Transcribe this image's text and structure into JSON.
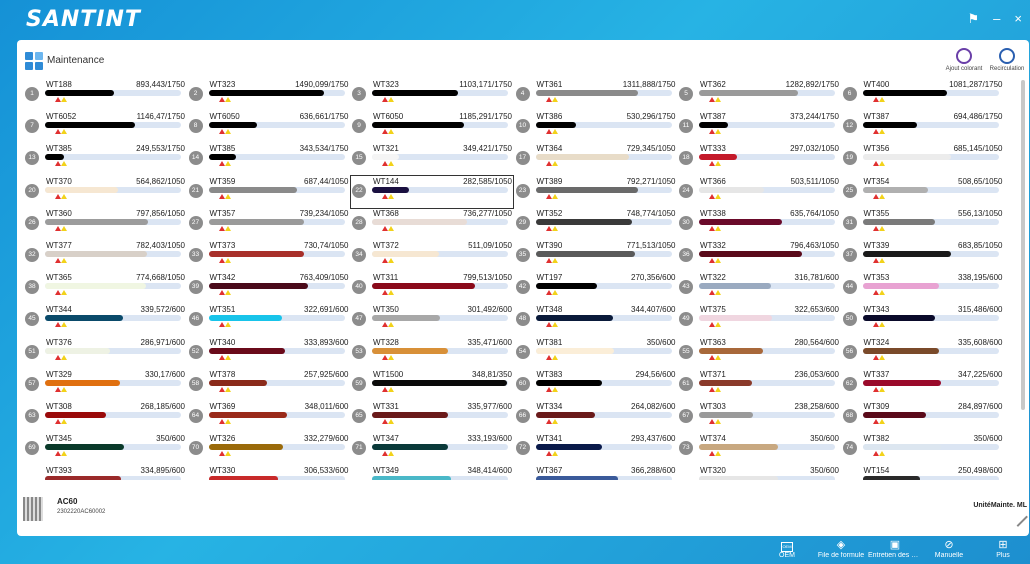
{
  "app": {
    "logo": "SANTINT",
    "theme_icon": "tshirt-icon",
    "minimize": "–",
    "close": "×"
  },
  "panel": {
    "title": "Maintenance",
    "buttons": [
      {
        "label": "Ajout colorant",
        "icon": "tank-icon"
      },
      {
        "label": "Recirculation",
        "icon": "recirculation-icon"
      }
    ]
  },
  "cells": [
    {
      "n": "1",
      "name": "WT188",
      "value": "893,443/1750",
      "fill": 0.51,
      "color": "#000000"
    },
    {
      "n": "2",
      "name": "WT323",
      "value": "1490,099/1750",
      "fill": 0.85,
      "color": "#000000"
    },
    {
      "n": "3",
      "name": "WT323",
      "value": "1103,171/1750",
      "fill": 0.63,
      "color": "#000000"
    },
    {
      "n": "4",
      "name": "WT361",
      "value": "1311,888/1750",
      "fill": 0.75,
      "color": "#8a8a8a"
    },
    {
      "n": "5",
      "name": "WT362",
      "value": "1282,892/1750",
      "fill": 0.73,
      "color": "#9a9a9a"
    },
    {
      "n": "6",
      "name": "WT400",
      "value": "1081,287/1750",
      "fill": 0.62,
      "color": "#000000"
    },
    {
      "n": "7",
      "name": "WT6052",
      "value": "1146,47/1750",
      "fill": 0.66,
      "color": "#000000"
    },
    {
      "n": "8",
      "name": "WT6050",
      "value": "636,661/1750",
      "fill": 0.36,
      "color": "#000000"
    },
    {
      "n": "9",
      "name": "WT6050",
      "value": "1185,291/1750",
      "fill": 0.68,
      "color": "#000000"
    },
    {
      "n": "10",
      "name": "WT386",
      "value": "530,296/1750",
      "fill": 0.3,
      "color": "#000000"
    },
    {
      "n": "11",
      "name": "WT387",
      "value": "373,244/1750",
      "fill": 0.21,
      "color": "#000000"
    },
    {
      "n": "12",
      "name": "WT387",
      "value": "694,486/1750",
      "fill": 0.4,
      "color": "#000000"
    },
    {
      "n": "13",
      "name": "WT385",
      "value": "249,553/1750",
      "fill": 0.14,
      "color": "#000000"
    },
    {
      "n": "14",
      "name": "WT385",
      "value": "343,534/1750",
      "fill": 0.2,
      "color": "#000000"
    },
    {
      "n": "15",
      "name": "WT321",
      "value": "349,421/1750",
      "fill": 0.2,
      "color": "#f5f5f5"
    },
    {
      "n": "17",
      "name": "WT364",
      "value": "729,345/1050",
      "fill": 0.69,
      "color": "#e8dcc8"
    },
    {
      "n": "18",
      "name": "WT333",
      "value": "297,032/1050",
      "fill": 0.28,
      "color": "#c41a2a"
    },
    {
      "n": "19",
      "name": "WT356",
      "value": "685,145/1050",
      "fill": 0.65,
      "color": "#ececec"
    },
    {
      "n": "20",
      "name": "WT370",
      "value": "564,862/1050",
      "fill": 0.54,
      "color": "#f6e7d2"
    },
    {
      "n": "21",
      "name": "WT359",
      "value": "687,44/1050",
      "fill": 0.65,
      "color": "#8a8a8a"
    },
    {
      "n": "22",
      "name": "WT144",
      "value": "282,585/1050",
      "fill": 0.27,
      "color": "#1a1040"
    },
    {
      "n": "23",
      "name": "WT389",
      "value": "792,271/1050",
      "fill": 0.75,
      "color": "#6a6a6a"
    },
    {
      "n": "24",
      "name": "WT366",
      "value": "503,511/1050",
      "fill": 0.48,
      "color": "#e6e6e6"
    },
    {
      "n": "25",
      "name": "WT354",
      "value": "508,65/1050",
      "fill": 0.48,
      "color": "#b0b0b0"
    },
    {
      "n": "26",
      "name": "WT360",
      "value": "797,856/1050",
      "fill": 0.76,
      "color": "#9c9c9c"
    },
    {
      "n": "27",
      "name": "WT357",
      "value": "739,234/1050",
      "fill": 0.7,
      "color": "#9a9a9a"
    },
    {
      "n": "28",
      "name": "WT368",
      "value": "736,277/1050",
      "fill": 0.7,
      "color": "#e8dcd6"
    },
    {
      "n": "29",
      "name": "WT352",
      "value": "748,774/1050",
      "fill": 0.71,
      "color": "#3a3a3a"
    },
    {
      "n": "30",
      "name": "WT338",
      "value": "635,764/1050",
      "fill": 0.61,
      "color": "#6a0a2a"
    },
    {
      "n": "31",
      "name": "WT355",
      "value": "556,13/1050",
      "fill": 0.53,
      "color": "#7a7a7a"
    },
    {
      "n": "32",
      "name": "WT377",
      "value": "782,403/1050",
      "fill": 0.75,
      "color": "#d8d0c8"
    },
    {
      "n": "33",
      "name": "WT373",
      "value": "730,74/1050",
      "fill": 0.7,
      "color": "#a8302a"
    },
    {
      "n": "34",
      "name": "WT372",
      "value": "511,09/1050",
      "fill": 0.49,
      "color": "#f6e7d2"
    },
    {
      "n": "35",
      "name": "WT390",
      "value": "771,513/1050",
      "fill": 0.73,
      "color": "#5a5a5a"
    },
    {
      "n": "36",
      "name": "WT332",
      "value": "796,463/1050",
      "fill": 0.76,
      "color": "#5a0a1a"
    },
    {
      "n": "37",
      "name": "WT339",
      "value": "683,85/1050",
      "fill": 0.65,
      "color": "#1a1a1a"
    },
    {
      "n": "38",
      "name": "WT365",
      "value": "774,668/1050",
      "fill": 0.74,
      "color": "#f0f6e2"
    },
    {
      "n": "39",
      "name": "WT342",
      "value": "763,409/1050",
      "fill": 0.73,
      "color": "#4a0a1a"
    },
    {
      "n": "40",
      "name": "WT311",
      "value": "799,513/1050",
      "fill": 0.76,
      "color": "#8a0a1a"
    },
    {
      "n": "42",
      "name": "WT197",
      "value": "270,356/600",
      "fill": 0.45,
      "color": "#000000"
    },
    {
      "n": "43",
      "name": "WT322",
      "value": "316,781/600",
      "fill": 0.53,
      "color": "#9aaac0"
    },
    {
      "n": "44",
      "name": "WT353",
      "value": "338,195/600",
      "fill": 0.56,
      "color": "#e8a2d2"
    },
    {
      "n": "45",
      "name": "WT344",
      "value": "339,572/600",
      "fill": 0.57,
      "color": "#0a4a6a"
    },
    {
      "n": "46",
      "name": "WT351",
      "value": "322,691/600",
      "fill": 0.54,
      "color": "#18c4ea"
    },
    {
      "n": "47",
      "name": "WT350",
      "value": "301,492/600",
      "fill": 0.5,
      "color": "#a8a8a8"
    },
    {
      "n": "48",
      "name": "WT348",
      "value": "344,407/600",
      "fill": 0.57,
      "color": "#0a1a3a"
    },
    {
      "n": "49",
      "name": "WT375",
      "value": "322,653/600",
      "fill": 0.54,
      "color": "#f0d6e0"
    },
    {
      "n": "50",
      "name": "WT343",
      "value": "315,486/600",
      "fill": 0.53,
      "color": "#0a0a2a"
    },
    {
      "n": "51",
      "name": "WT376",
      "value": "286,971/600",
      "fill": 0.48,
      "color": "#eef2e4"
    },
    {
      "n": "52",
      "name": "WT340",
      "value": "333,893/600",
      "fill": 0.56,
      "color": "#6a0a1a"
    },
    {
      "n": "53",
      "name": "WT328",
      "value": "335,471/600",
      "fill": 0.56,
      "color": "#d89038"
    },
    {
      "n": "54",
      "name": "WT381",
      "value": "350/600",
      "fill": 0.58,
      "color": "#fbeed8"
    },
    {
      "n": "55",
      "name": "WT363",
      "value": "280,564/600",
      "fill": 0.47,
      "color": "#a8683a"
    },
    {
      "n": "56",
      "name": "WT324",
      "value": "335,608/600",
      "fill": 0.56,
      "color": "#7a4a2a"
    },
    {
      "n": "57",
      "name": "WT329",
      "value": "330,17/600",
      "fill": 0.55,
      "color": "#e07010"
    },
    {
      "n": "58",
      "name": "WT378",
      "value": "257,925/600",
      "fill": 0.43,
      "color": "#8a2a1a"
    },
    {
      "n": "59",
      "name": "WT1500",
      "value": "348,81/350",
      "fill": 0.99,
      "color": "#0a0a0a"
    },
    {
      "n": "60",
      "name": "WT383",
      "value": "294,56/600",
      "fill": 0.49,
      "color": "#000000"
    },
    {
      "n": "61",
      "name": "WT371",
      "value": "236,053/600",
      "fill": 0.39,
      "color": "#8a3a2a"
    },
    {
      "n": "62",
      "name": "WT337",
      "value": "347,225/600",
      "fill": 0.58,
      "color": "#9a0a2a"
    },
    {
      "n": "63",
      "name": "WT308",
      "value": "268,185/600",
      "fill": 0.45,
      "color": "#9a0a0a"
    },
    {
      "n": "64",
      "name": "WT369",
      "value": "348,011/600",
      "fill": 0.58,
      "color": "#9a2a1a"
    },
    {
      "n": "65",
      "name": "WT331",
      "value": "335,977/600",
      "fill": 0.56,
      "color": "#6a1a1a"
    },
    {
      "n": "66",
      "name": "WT334",
      "value": "264,082/600",
      "fill": 0.44,
      "color": "#6a1a1a"
    },
    {
      "n": "67",
      "name": "WT303",
      "value": "238,258/600",
      "fill": 0.4,
      "color": "#9a9a9a"
    },
    {
      "n": "68",
      "name": "WT309",
      "value": "284,897/600",
      "fill": 0.47,
      "color": "#5a0a1a"
    },
    {
      "n": "69",
      "name": "WT345",
      "value": "350/600",
      "fill": 0.58,
      "color": "#0a3a2a"
    },
    {
      "n": "70",
      "name": "WT326",
      "value": "332,279/600",
      "fill": 0.55,
      "color": "#9a6a0a"
    },
    {
      "n": "71",
      "name": "WT347",
      "value": "333,193/600",
      "fill": 0.56,
      "color": "#0a3a3a"
    },
    {
      "n": "72",
      "name": "WT341",
      "value": "293,437/600",
      "fill": 0.49,
      "color": "#0a1a4a"
    },
    {
      "n": "73",
      "name": "WT374",
      "value": "350/600",
      "fill": 0.58,
      "color": "#c8a880"
    },
    {
      "n": "74",
      "name": "WT382",
      "value": "350/600",
      "fill": 0.58,
      "color": "#dce6f0"
    },
    {
      "n": "",
      "name": "WT393",
      "value": "334,895/600",
      "fill": 0.56,
      "color": "#9a2a2a"
    },
    {
      "n": "",
      "name": "WT330",
      "value": "306,533/600",
      "fill": 0.51,
      "color": "#c82a2a"
    },
    {
      "n": "",
      "name": "WT349",
      "value": "348,414/600",
      "fill": 0.58,
      "color": "#4ab8c8"
    },
    {
      "n": "",
      "name": "WT367",
      "value": "366,288/600",
      "fill": 0.61,
      "color": "#3a5a9a"
    },
    {
      "n": "",
      "name": "WT320",
      "value": "350/600",
      "fill": 0.58,
      "color": "#e6e6e6"
    },
    {
      "n": "",
      "name": "WT154",
      "value": "250,498/600",
      "fill": 0.42,
      "color": "#2a2a2a"
    }
  ],
  "selected_index": 20,
  "device": {
    "name": "AC60",
    "serial": "2302220AC60002"
  },
  "unit_label": "UnitéMainte. ML",
  "taskbar": [
    {
      "label": "OEM",
      "icon": "oem-icon"
    },
    {
      "label": "File de formule",
      "icon": "queue-icon"
    },
    {
      "label": "Entretien des équipements",
      "icon": "monitor-icon"
    },
    {
      "label": "Manuelle",
      "icon": "manual-icon"
    },
    {
      "label": "Plus",
      "icon": "grid-icon"
    }
  ]
}
